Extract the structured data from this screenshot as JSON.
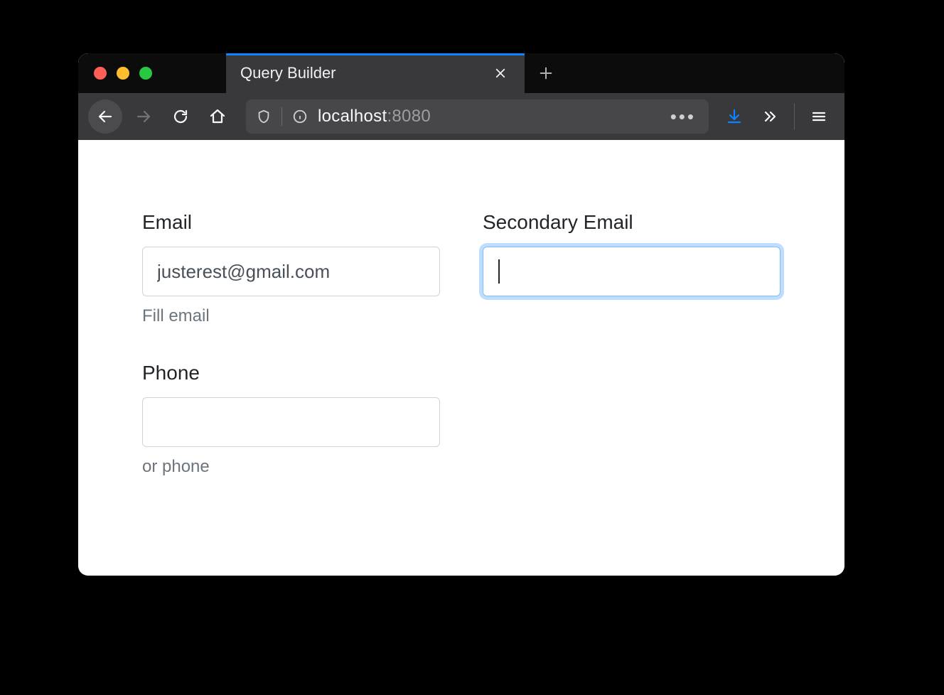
{
  "browser": {
    "tab_title": "Query Builder",
    "url_host": "localhost",
    "url_port": ":8080"
  },
  "form": {
    "email_label": "Email",
    "email_value": "justerest@gmail.com",
    "email_help": "Fill email",
    "secondary_email_label": "Secondary Email",
    "secondary_email_value": "",
    "phone_label": "Phone",
    "phone_value": "",
    "phone_help": "or phone"
  }
}
